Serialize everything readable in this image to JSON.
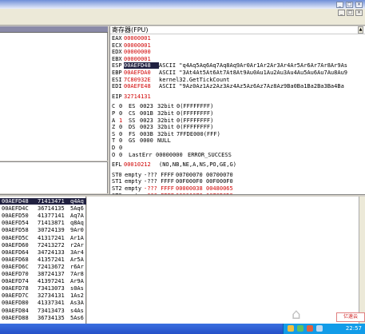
{
  "window": {
    "minimize_glyph": "_",
    "restore_glyph": "□",
    "close_glyph": "×"
  },
  "registers_panel": {
    "title": "寄存器(FPU)",
    "up_glyph": "▲",
    "rows": [
      {
        "name": "EAX",
        "value": "00000001",
        "comment": ""
      },
      {
        "name": "ECX",
        "value": "00000001",
        "comment": ""
      },
      {
        "name": "EDX",
        "value": "00000000",
        "comment": ""
      },
      {
        "name": "EBX",
        "value": "00000001",
        "comment": ""
      },
      {
        "name": "ESP",
        "value": "00AEFD48",
        "comment": "ASCII \"q4Aq5Aq6Aq7Aq8Aq9Ar0Ar1Ar2Ar3Ar4Ar5Ar6Ar7Ar8Ar9As",
        "selected": true
      },
      {
        "name": "EBP",
        "value": "00AEFDA0",
        "comment": "ASCII \"3At4At5At6At7At8At9Au0Au1Au2Au3Au4Au5Au6Au7Au8Au9"
      },
      {
        "name": "ESI",
        "value": "7C80932E",
        "comment": "kernel32.GetTickCount"
      },
      {
        "name": "EDI",
        "value": "00AEFE48",
        "comment": "ASCII \"9Az0Az1Az2Az3Az4Az5Az6Az7Az8Az9Ba0Ba1Ba2Ba3Ba4Ba"
      }
    ],
    "eip": {
      "name": "EIP",
      "value": "32714131"
    },
    "segments": [
      {
        "flag": "C",
        "bit": "0",
        "seg": "ES",
        "sel": "0023",
        "bits": "32bit",
        "base": "0(FFFFFFFF)"
      },
      {
        "flag": "P",
        "bit": "0",
        "seg": "CS",
        "sel": "001B",
        "bits": "32bit",
        "base": "0(FFFFFFFF)"
      },
      {
        "flag": "A",
        "bit": "1",
        "seg": "SS",
        "sel": "0023",
        "bits": "32bit",
        "base": "0(FFFFFFFF)"
      },
      {
        "flag": "Z",
        "bit": "0",
        "seg": "DS",
        "sel": "0023",
        "bits": "32bit",
        "base": "0(FFFFFFFF)"
      },
      {
        "flag": "S",
        "bit": "0",
        "seg": "FS",
        "sel": "003B",
        "bits": "32bit",
        "base": "7FFDE000(FFF)"
      },
      {
        "flag": "T",
        "bit": "0",
        "seg": "GS",
        "sel": "0000",
        "bits": "NULL",
        "base": ""
      },
      {
        "flag": "D",
        "bit": "0",
        "seg": "",
        "sel": "",
        "bits": "",
        "base": ""
      }
    ],
    "lasterr": {
      "flag": "O",
      "bit": "0",
      "label": "LastErr",
      "value": "00000000",
      "text": "ERROR_SUCCESS"
    },
    "efl": {
      "name": "EFL",
      "value": "00010212",
      "text": "(NO,NB,NE,A,NS,PO,GE,G)"
    },
    "fpu": [
      {
        "name": "ST0",
        "state": "empty",
        "q": "-??? FFFF",
        "a": "00700070",
        "b": "00700070"
      },
      {
        "name": "ST1",
        "state": "empty",
        "q": "-??? FFFF",
        "a": "00F000F0",
        "b": "00F000F0"
      },
      {
        "name": "ST2",
        "state": "empty",
        "q": "-??? FFFF",
        "a": "00000038",
        "b": "00480065"
      },
      {
        "name": "ST3",
        "state": "empty",
        "q": "-??? FFFF",
        "a": "00000078",
        "b": "0078B0D9"
      }
    ]
  },
  "dump": {
    "rows": [
      {
        "addr": "00AEFD48",
        "value": "71413471",
        "text": "q4Aq",
        "selected": true
      },
      {
        "addr": "00AEFD4C",
        "value": "36714135",
        "text": "5Aq6"
      },
      {
        "addr": "00AEFD50",
        "value": "41377141",
        "text": "Aq7A"
      },
      {
        "addr": "00AEFD54",
        "value": "71413871",
        "text": "q8Aq"
      },
      {
        "addr": "00AEFD58",
        "value": "30724139",
        "text": "9Ar0"
      },
      {
        "addr": "00AEFD5C",
        "value": "41317241",
        "text": "Ar1A"
      },
      {
        "addr": "00AEFD60",
        "value": "72413272",
        "text": "r2Ar"
      },
      {
        "addr": "00AEFD64",
        "value": "34724133",
        "text": "3Ar4"
      },
      {
        "addr": "00AEFD68",
        "value": "41357241",
        "text": "Ar5A"
      },
      {
        "addr": "00AEFD6C",
        "value": "72413672",
        "text": "r6Ar"
      },
      {
        "addr": "00AEFD70",
        "value": "38724137",
        "text": "7Ar8"
      },
      {
        "addr": "00AEFD74",
        "value": "41397241",
        "text": "Ar9A"
      },
      {
        "addr": "00AEFD78",
        "value": "73413073",
        "text": "s0As"
      },
      {
        "addr": "00AEFD7C",
        "value": "32734131",
        "text": "1As2"
      },
      {
        "addr": "00AEFD80",
        "value": "41337341",
        "text": "As3A"
      },
      {
        "addr": "00AEFD84",
        "value": "73413473",
        "text": "s4As"
      },
      {
        "addr": "00AEFD88",
        "value": "36734135",
        "text": "5As6"
      }
    ]
  },
  "taskbar": {
    "clock": "22:57",
    "watermark": "亿速云"
  },
  "colors": {
    "register_value": "#d00000",
    "selection_bg": "#202040",
    "taskbar": "#2550c8"
  }
}
